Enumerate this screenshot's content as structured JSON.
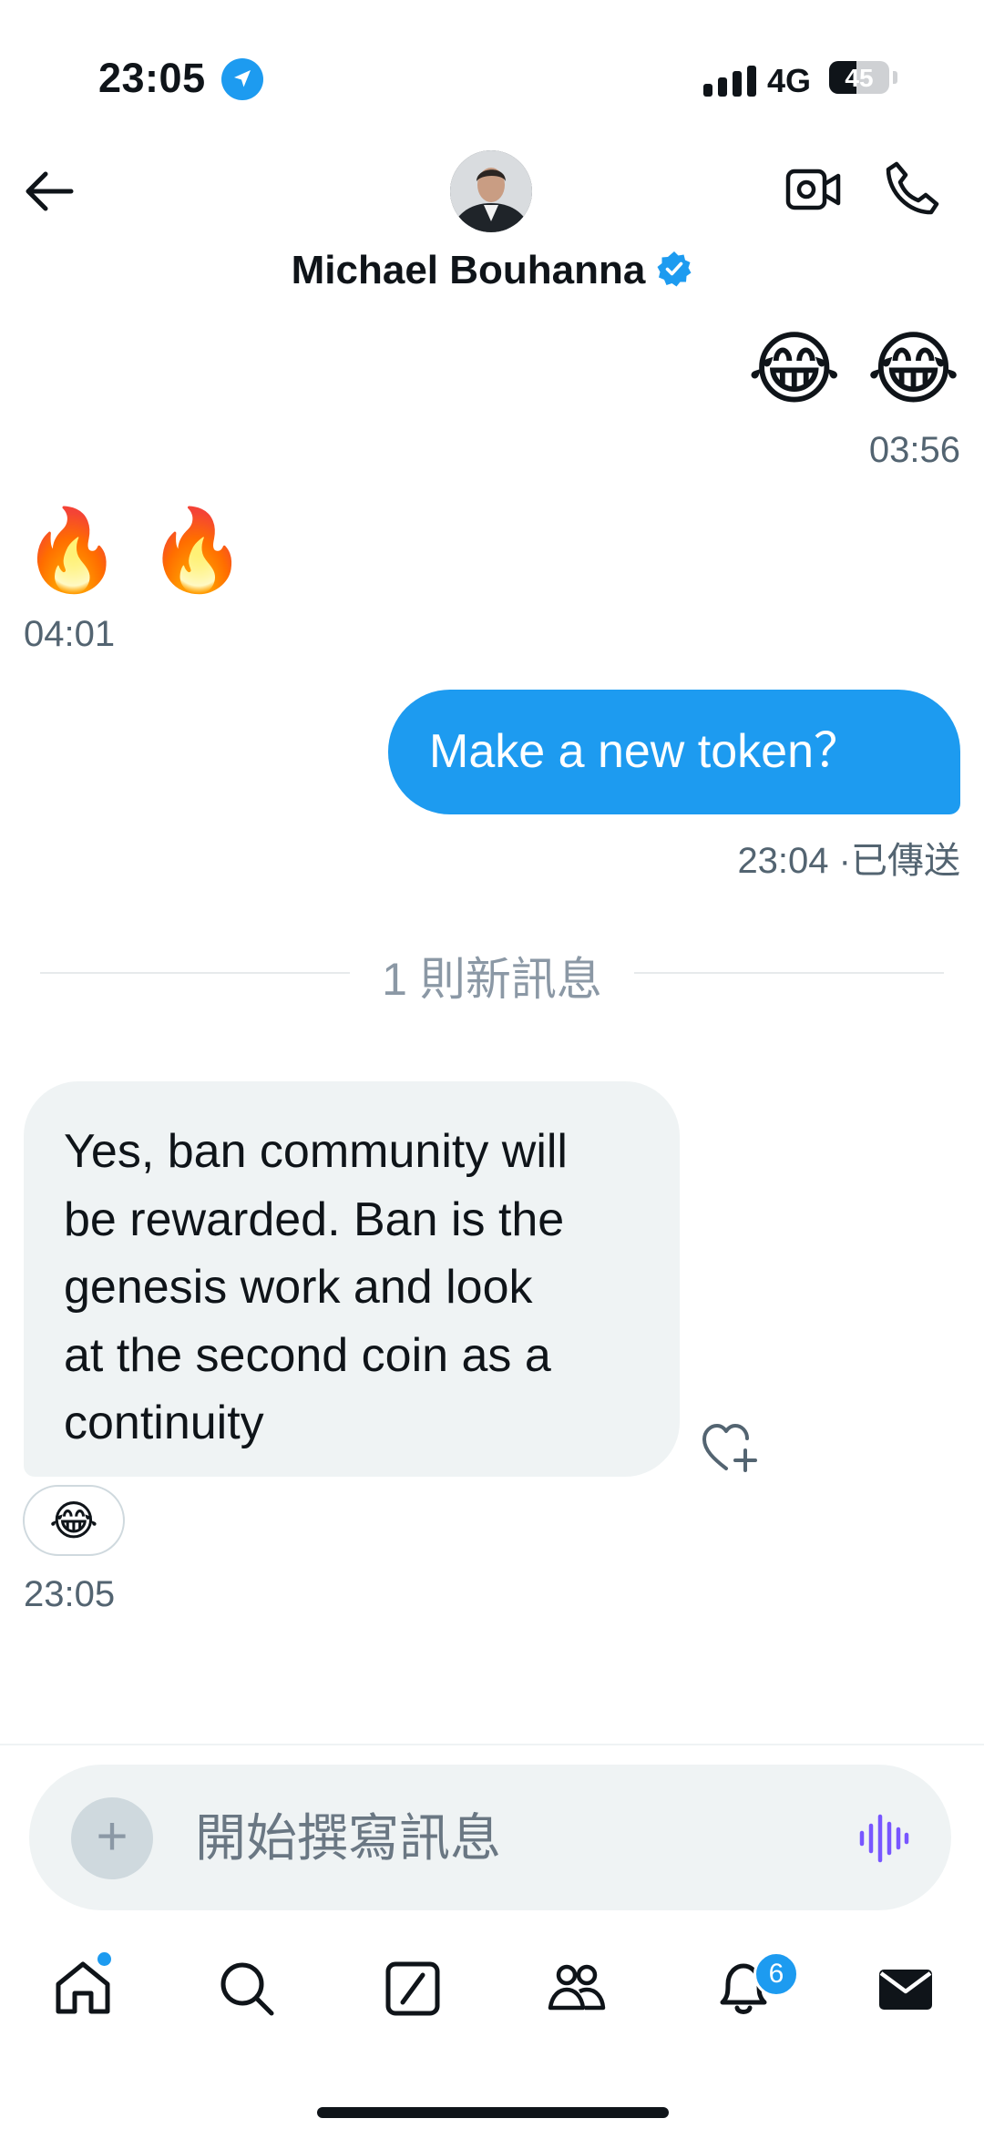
{
  "status_bar": {
    "time": "23:05",
    "network": "4G",
    "battery": "45",
    "battery_level": 0.45
  },
  "header": {
    "contact_name": "Michael Bouhanna",
    "verified": true
  },
  "messages": [
    {
      "direction": "outgoing",
      "emoji": "😂 😂",
      "time": "03:56"
    },
    {
      "direction": "incoming",
      "emoji": "🔥 🔥",
      "time": "04:01"
    },
    {
      "direction": "outgoing",
      "text": "Make a new token？",
      "time": "23:04",
      "status": "·已傳送"
    },
    {
      "direction": "incoming",
      "text_lines": [
        "Yes, ban community will",
        "be rewarded. Ban is the",
        "genesis work and look",
        "at the second coin as a",
        "continuity"
      ],
      "reaction": "😂",
      "time": "23:05"
    }
  ],
  "new_messages_divider": "1 則新訊息",
  "composer": {
    "placeholder": "開始撰寫訊息",
    "plus": "+"
  },
  "bottom_nav": {
    "items": [
      "home-icon",
      "search-icon",
      "grok-icon",
      "communities-icon",
      "notifications-icon",
      "messages-icon"
    ],
    "notifications_badge": "6"
  },
  "colors": {
    "accent": "#1d9bf0",
    "incoming_bubble": "#eff3f4",
    "timestamp": "#536471",
    "voice": "#7856ff"
  }
}
